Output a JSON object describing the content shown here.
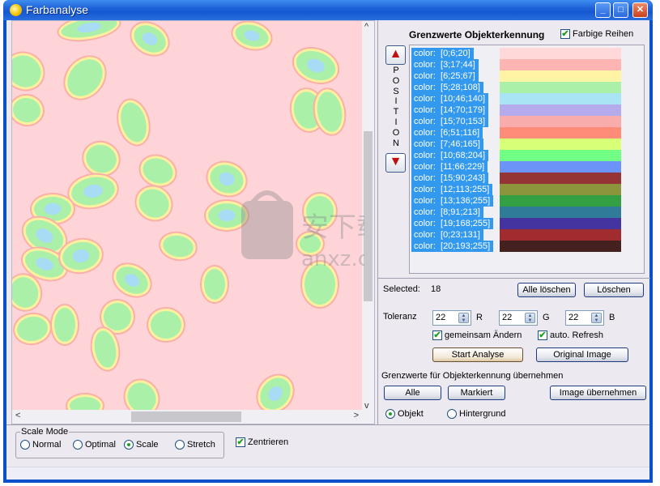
{
  "window": {
    "title": "Farbanalyse",
    "controls": {
      "minimize": "_",
      "maximize": "□",
      "close": "✕"
    }
  },
  "image_view": {
    "scroll_left": "<",
    "scroll_right": ">",
    "scroll_up": "^",
    "scroll_down": "v"
  },
  "thresholds": {
    "heading": "Grenzwerte Objekterkennung",
    "colored_rows_label": "Farbige Reihen",
    "colored_rows_checked": true,
    "position_label": [
      "P",
      "O",
      "S",
      "I",
      "T",
      "I",
      "O",
      "N"
    ],
    "up_icon": "▲",
    "down_icon": "▼",
    "items": [
      {
        "label": "color:  [0;6;20]",
        "swatch": "#ffd8da"
      },
      {
        "label": "color:  [3;17;44]",
        "swatch": "#ffb4b4"
      },
      {
        "label": "color:  [6;25;67]",
        "swatch": "#fff4a4"
      },
      {
        "label": "color:  [5;28;108]",
        "swatch": "#aaf0a8"
      },
      {
        "label": "color:  [10;46;140]",
        "swatch": "#a8e4f4"
      },
      {
        "label": "color:  [14;70;179]",
        "swatch": "#b4aaec"
      },
      {
        "label": "color:  [15;70;153]",
        "swatch": "#f8acac"
      },
      {
        "label": "color:  [6;51;116]",
        "swatch": "#ff8c78"
      },
      {
        "label": "color:  [7;46;165]",
        "swatch": "#d8ff78"
      },
      {
        "label": "color:  [10;68;204]",
        "swatch": "#70ff84"
      },
      {
        "label": "color:  [11;66;229]",
        "swatch": "#6c94f8"
      },
      {
        "label": "color:  [15;90;243]",
        "swatch": "#943434"
      },
      {
        "label": "color:  [12;113;255]",
        "swatch": "#8c943c"
      },
      {
        "label": "color:  [13;136;255]",
        "swatch": "#34a044"
      },
      {
        "label": "color:  [8;91;213]",
        "swatch": "#307c98"
      },
      {
        "label": "color:  [19;168;255]",
        "swatch": "#4434a0"
      },
      {
        "label": "color:  [0;23;131]",
        "swatch": "#a02c30"
      },
      {
        "label": "color:  [20;193;255]",
        "swatch": "#44201e"
      }
    ]
  },
  "selection": {
    "selected_label": "Selected:",
    "selected_count": "18",
    "clear_all_button": "Alle löschen",
    "delete_button": "Löschen"
  },
  "tolerance": {
    "label": "Toleranz",
    "r_value": "22",
    "r_label": "R",
    "g_value": "22",
    "g_label": "G",
    "b_value": "22",
    "b_label": "B",
    "change_together_label": "gemeinsam Ändern",
    "change_together_checked": true,
    "auto_refresh_label": "auto. Refresh",
    "auto_refresh_checked": true,
    "start_analysis_button": "Start Analyse",
    "original_image_button": "Original Image"
  },
  "apply": {
    "label": "Grenzwerte für Objekterkennung übernehmen",
    "all_button": "Alle",
    "marked_button": "Markiert",
    "apply_image_button": "Image übernehmen",
    "object_label": "Objekt",
    "background_label": "Hintergrund",
    "selected_target": "Objekt"
  },
  "scale_mode": {
    "title": "Scale Mode",
    "options": [
      "Normal",
      "Optimal",
      "Scale",
      "Stretch"
    ],
    "selected": "Scale",
    "center_label": "Zentrieren",
    "center_checked": true
  },
  "watermark": {
    "text": "安下载",
    "subtext": "anxz.com"
  }
}
